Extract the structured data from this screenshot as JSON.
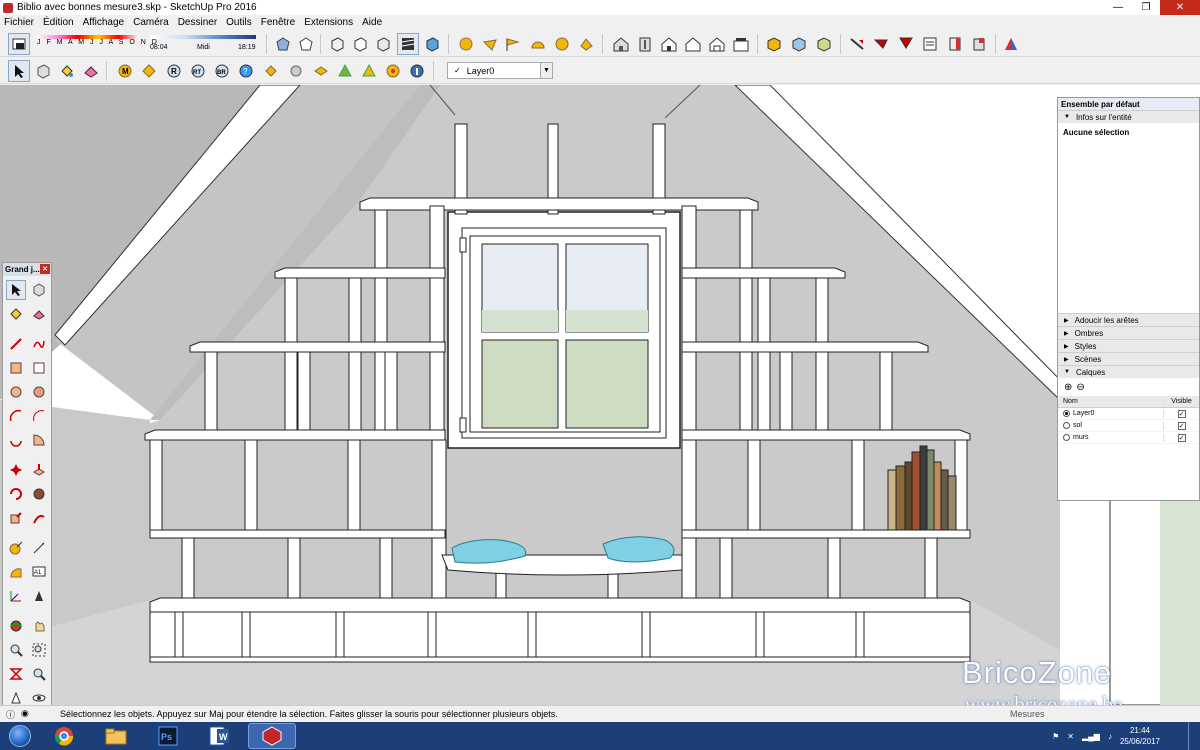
{
  "window": {
    "title": "Biblio avec bonnes mesure3.skp - SketchUp Pro 2016"
  },
  "menu": [
    "Fichier",
    "Édition",
    "Affichage",
    "Caméra",
    "Dessiner",
    "Outils",
    "Fenêtre",
    "Extensions",
    "Aide"
  ],
  "shadow_settings": {
    "months": "J F M A M J J A S O N D",
    "time_start": "08:04",
    "time_mid": "Midi",
    "time_end": "18:19"
  },
  "layer_dropdown": {
    "value": "Layer0"
  },
  "tool_palette": {
    "title": "Grand j..."
  },
  "tray": {
    "title": "Ensemble par défaut",
    "entity_info": {
      "label": "Infos sur l'entité",
      "content": "Aucune sélection"
    },
    "sections": [
      "Adoucir les arêtes",
      "Ombres",
      "Styles",
      "Scènes"
    ],
    "layers": {
      "label": "Calques",
      "col_name": "Nom",
      "col_visible": "Visible",
      "rows": [
        {
          "name": "Layer0",
          "active": true,
          "visible": true
        },
        {
          "name": "sol",
          "active": false,
          "visible": true
        },
        {
          "name": "murs",
          "active": false,
          "visible": true
        }
      ]
    }
  },
  "status": {
    "text": "Sélectionnez les objets. Appuyez sur Maj pour étendre la sélection. Faites glisser la souris pour sélectionner plusieurs objets.",
    "measure_label": "Mesures"
  },
  "taskbar": {
    "time": "21:44",
    "date": "25/06/2017"
  },
  "watermark": {
    "brand": "BricoZone",
    "url": "www.bricozone.be"
  },
  "colors": {
    "accent_selection": "#dfe8f3",
    "close": "#c42b1c",
    "taskbar": "#1c3f7a",
    "cushion": "#7fd0e4",
    "wall": "#c8c8c8"
  },
  "icons": {
    "toolbar_row1": [
      "select-icon",
      "eraser-icon",
      "house-icon",
      "cube-icon",
      "styles-icon",
      "sandbox-icon"
    ],
    "toolbar_row2": [
      "select-icon",
      "component-icon",
      "paint-icon",
      "eraser-icon",
      "extension-icons"
    ]
  }
}
